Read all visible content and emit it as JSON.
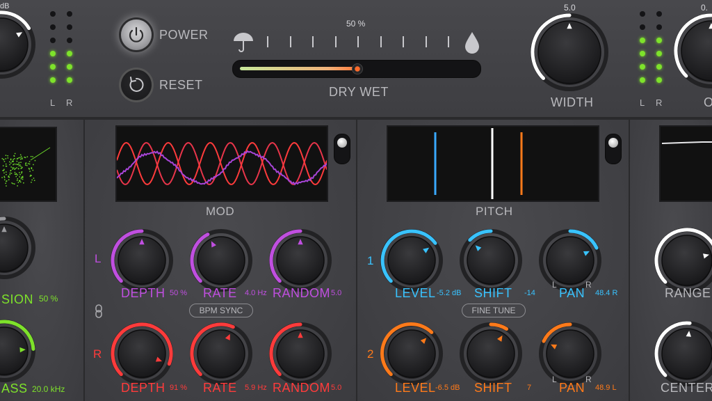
{
  "colors": {
    "magenta": "#c04fe0",
    "red": "#ff3b3b",
    "blue": "#39c3ff",
    "orange": "#ff7a1a",
    "green": "#7ee22b",
    "white": "#ffffff",
    "label": "#b9b9bd"
  },
  "top": {
    "left_knob_value": "dB",
    "power_label": "POWER",
    "reset_label": "RESET",
    "drywet_percent": "50 %",
    "drywet_label": "DRY WET",
    "drywet_level": 0.5,
    "width_value": "5.0",
    "width_label": "WIDTH",
    "right_knob_value": "0.",
    "right_knob_label_partial": "O",
    "meter_l": "L",
    "meter_r": "R",
    "left_meter_lit": 3,
    "right_meter_lit": 4
  },
  "left_panel": {
    "label_1": "SION",
    "value_1": "50 %",
    "label_2": "ASS",
    "value_2": "20.0 kHz"
  },
  "mod": {
    "title": "MOD",
    "row_l_label": "L",
    "row_r_label": "R",
    "bpm_sync": "BPM SYNC",
    "l": {
      "depth_label": "DEPTH",
      "depth_value": "50 %",
      "depth_level": 0.5,
      "rate_label": "RATE",
      "rate_value": "4.0 Hz",
      "rate_level": 0.4,
      "random_label": "RANDOM",
      "random_value": "5.0",
      "random_level": 0.5
    },
    "r": {
      "depth_label": "DEPTH",
      "depth_value": "91 %",
      "depth_level": 0.91,
      "rate_label": "RATE",
      "rate_value": "5.9 Hz",
      "rate_level": 0.59,
      "random_label": "RANDOM",
      "random_value": "5.0",
      "random_level": 0.5
    }
  },
  "pitch": {
    "title": "PITCH",
    "row_1_label": "1",
    "row_2_label": "2",
    "fine_tune": "FINE TUNE",
    "pan_l": "L",
    "pan_r": "R",
    "v1": {
      "level_label": "LEVEL",
      "level_value": "-5.2 dB",
      "level_level": 0.7,
      "shift_label": "SHIFT",
      "shift_value": "-14",
      "shift_level": 0.33,
      "pan_label": "PAN",
      "pan_value": "48.4 R",
      "pan_level": 0.74
    },
    "v2": {
      "level_label": "LEVEL",
      "level_value": "-6.5 dB",
      "level_level": 0.66,
      "shift_label": "SHIFT",
      "shift_value": "7",
      "shift_level": 0.62,
      "pan_label": "PAN",
      "pan_value": "48.9 L",
      "pan_level": 0.26
    }
  },
  "right_panel": {
    "range_label": "RANGE",
    "center_label": "CENTER"
  }
}
